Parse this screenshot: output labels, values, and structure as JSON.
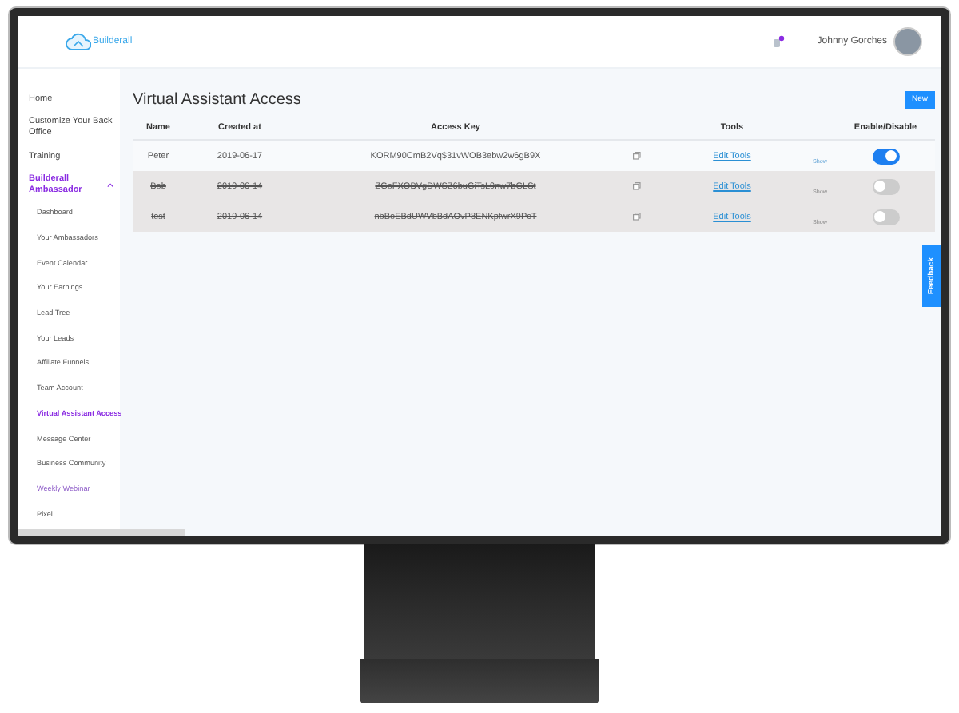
{
  "header": {
    "logo_text": "Builderall",
    "user_name": "Johnny Gorches"
  },
  "sidebar": {
    "items": [
      {
        "label": "Home",
        "kind": "item",
        "selected": false
      },
      {
        "label": "Customize Your Back Office",
        "kind": "item",
        "selected": false
      },
      {
        "label": "Training",
        "kind": "item",
        "selected": false
      },
      {
        "label": "Builderall Ambassador",
        "kind": "group",
        "selected": true,
        "expanded": true,
        "children": [
          {
            "label": "Dashboard",
            "kind": "item",
            "selected": false
          },
          {
            "label": "Your Ambassadors",
            "kind": "item",
            "selected": false
          },
          {
            "label": "Event Calendar",
            "kind": "item",
            "selected": false
          },
          {
            "label": "Your Earnings",
            "kind": "item",
            "selected": false
          },
          {
            "label": "Lead Tree",
            "kind": "item",
            "selected": false
          },
          {
            "label": "Your Leads",
            "kind": "item",
            "selected": false
          },
          {
            "label": "Affiliate Funnels",
            "kind": "item",
            "selected": false
          },
          {
            "label": "Team Account",
            "kind": "item",
            "selected": false
          },
          {
            "label": "Virtual Assistant Access",
            "kind": "item",
            "selected": true
          },
          {
            "label": "Message Center",
            "kind": "item",
            "selected": false
          },
          {
            "label": "Business Community",
            "kind": "item",
            "selected": false
          },
          {
            "label": "Weekly Webinar",
            "kind": "link",
            "selected": false
          },
          {
            "label": "Pixel",
            "kind": "item",
            "selected": false
          }
        ]
      }
    ]
  },
  "page": {
    "title": "Virtual Assistant Access",
    "new_button": "New",
    "table": {
      "columns": [
        "Name",
        "Created at",
        "Access Key",
        "Tools",
        "Enable/Disable"
      ],
      "rows": [
        {
          "name": "Peter",
          "created_at": "2019-06-17",
          "access_key": "KORM90CmB2Vq$31vWOB3ebw2w6gB9X",
          "tools": "Edit Tools",
          "show": "Show",
          "enabled": true
        },
        {
          "name": "Bob",
          "created_at": "2019-06-14",
          "access_key": "ZGoFXOBVgDWSZ6buGiTsL9nw7bGLSt",
          "tools": "Edit Tools",
          "show": "Show",
          "enabled": false
        },
        {
          "name": "test",
          "created_at": "2019-06-14",
          "access_key": "nbBoEBdUWVbBdAOvP8ENKpfwrX9PcT",
          "tools": "Edit Tools",
          "show": "Show",
          "enabled": false
        }
      ]
    }
  },
  "feedback_tab": {
    "label": "Feedback"
  }
}
